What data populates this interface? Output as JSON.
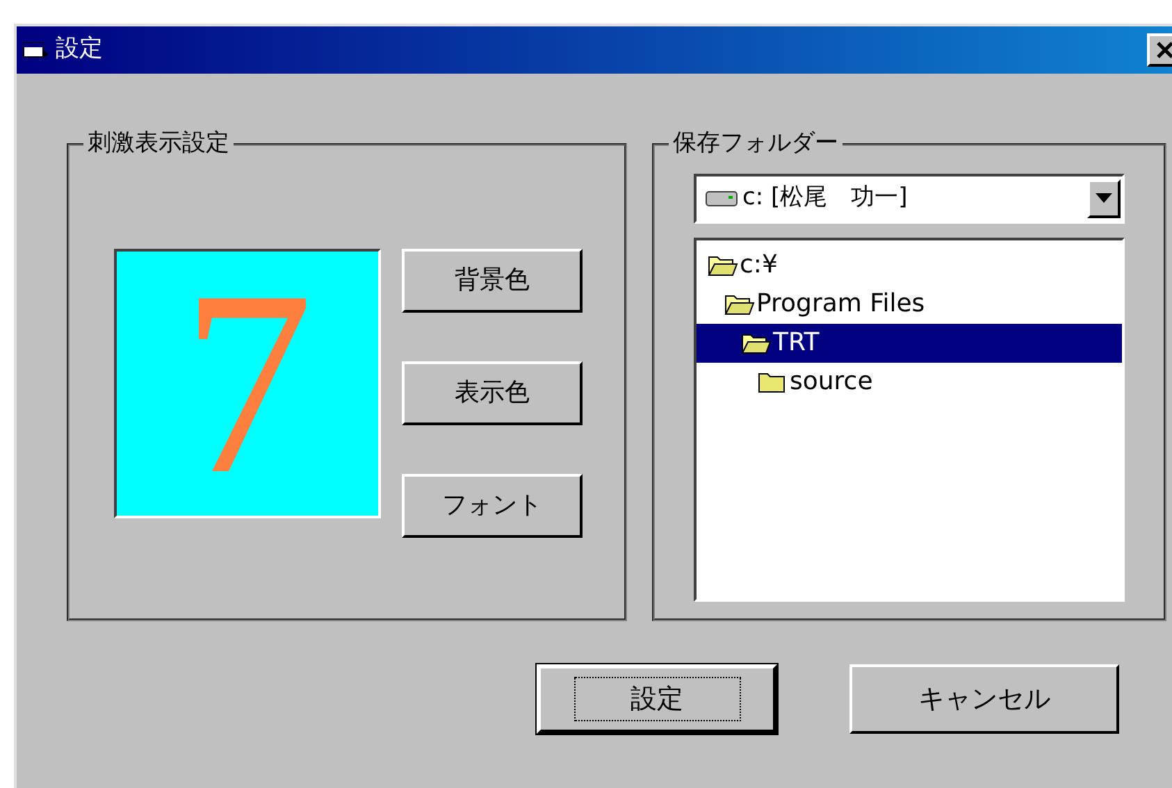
{
  "window": {
    "title": "設定"
  },
  "stimulus_group": {
    "label": "刺激表示設定",
    "preview": {
      "text": "7",
      "color": "#ff7f3f",
      "background": {
        "color": "#00ffff"
      }
    },
    "buttons": [
      "背景色",
      "表示色",
      "フォント"
    ]
  },
  "folder_group": {
    "label": "保存フォルダー",
    "drive": {
      "value": "c: [松尾　功一]"
    },
    "tree": [
      {
        "label": "c:¥",
        "selected": false,
        "expanded": true,
        "children": [
          {
            "label": "Program Files",
            "selected": false,
            "expanded": true,
            "children": [
              {
                "label": "TRT",
                "selected": true,
                "expanded": true,
                "children": [
                  {
                    "label": "source",
                    "selected": false,
                    "expanded": false
                  }
                ]
              }
            ]
          }
        ]
      }
    ]
  },
  "buttons": [
    {
      "label": "設定",
      "default": true
    },
    {
      "label": "キャンセル",
      "default": false
    }
  ]
}
